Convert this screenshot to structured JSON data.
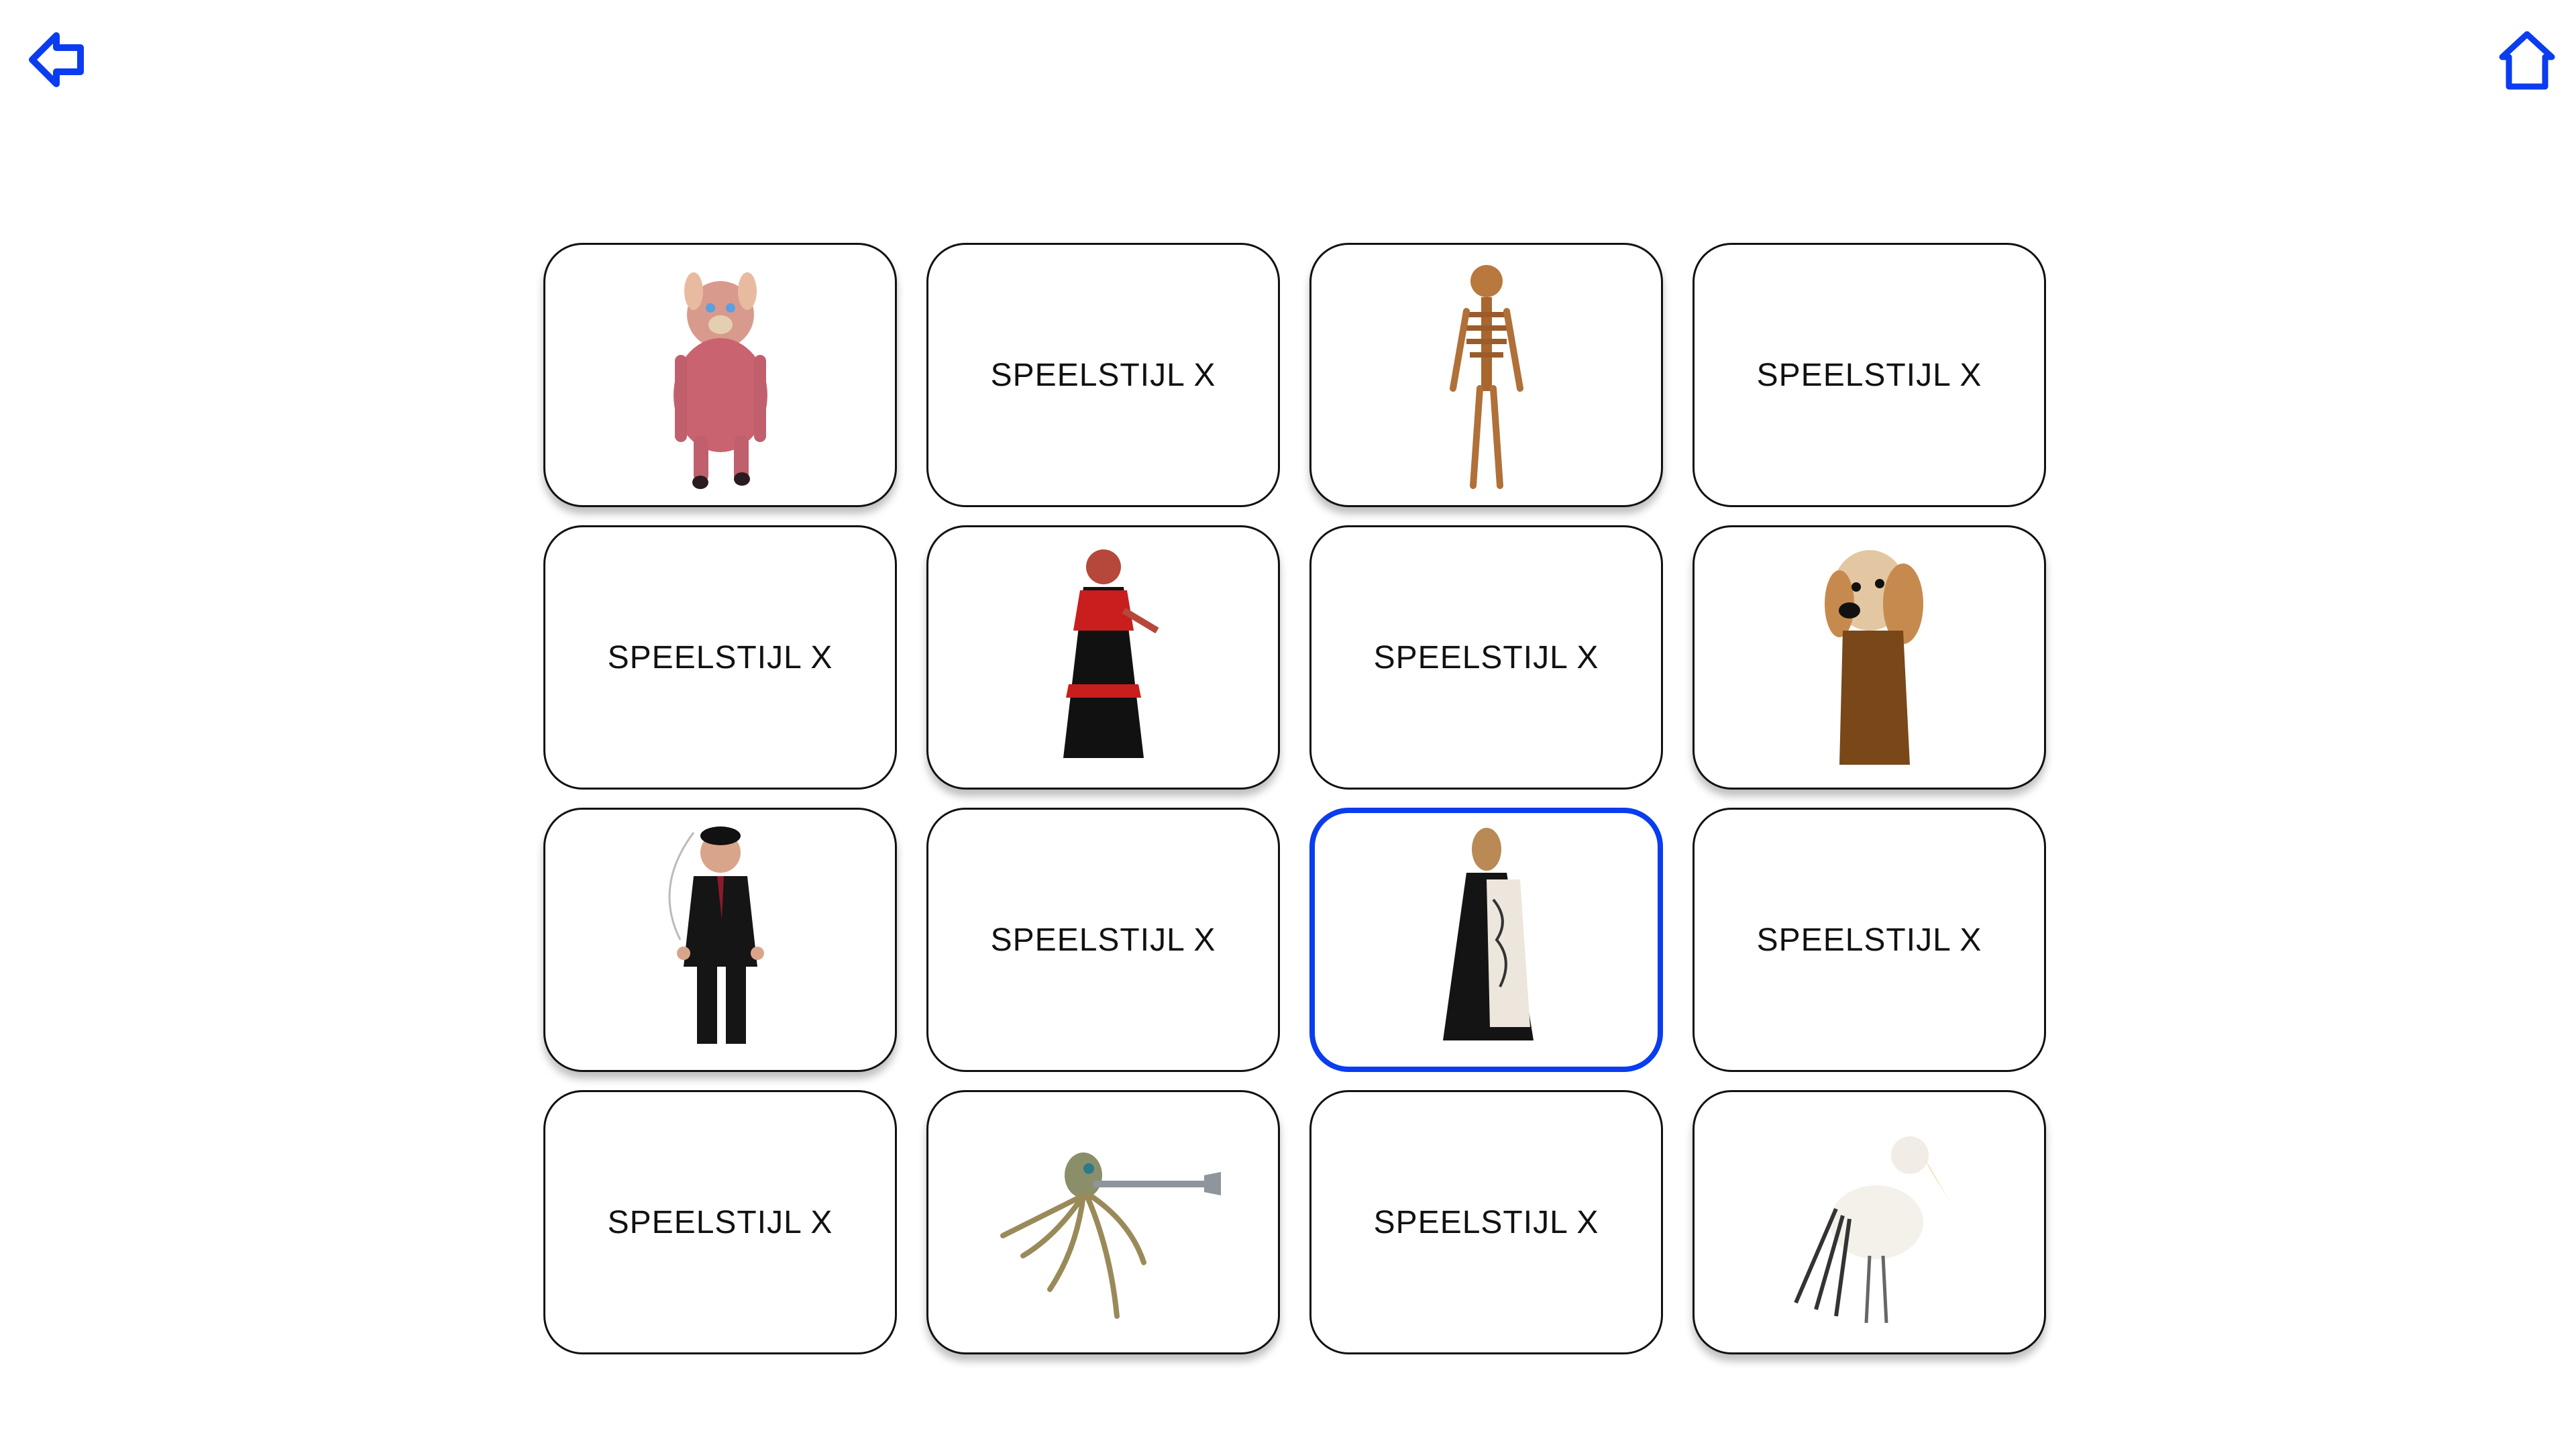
{
  "nav": {
    "back_icon": "arrow-left-outline-icon",
    "home_icon": "home-outline-icon",
    "accent": "#0a3cf0"
  },
  "cards": [
    {
      "kind": "image",
      "subject": "pig-puppet"
    },
    {
      "kind": "text",
      "label": "SPEELSTIJL X"
    },
    {
      "kind": "image",
      "subject": "skeleton-puppet"
    },
    {
      "kind": "text",
      "label": "SPEELSTIJL X"
    },
    {
      "kind": "text",
      "label": "SPEELSTIJL X"
    },
    {
      "kind": "image",
      "subject": "devil-puppet"
    },
    {
      "kind": "text",
      "label": "SPEELSTIJL X"
    },
    {
      "kind": "image",
      "subject": "dog-puppet"
    },
    {
      "kind": "image",
      "subject": "man-in-suit-puppet"
    },
    {
      "kind": "text",
      "label": "SPEELSTIJL X"
    },
    {
      "kind": "image",
      "subject": "cloaked-figure-puppet",
      "selected": true
    },
    {
      "kind": "text",
      "label": "SPEELSTIJL X"
    },
    {
      "kind": "text",
      "label": "SPEELSTIJL X"
    },
    {
      "kind": "image",
      "subject": "octopus-puppet"
    },
    {
      "kind": "text",
      "label": "SPEELSTIJL X"
    },
    {
      "kind": "image",
      "subject": "bird-puppet"
    }
  ]
}
